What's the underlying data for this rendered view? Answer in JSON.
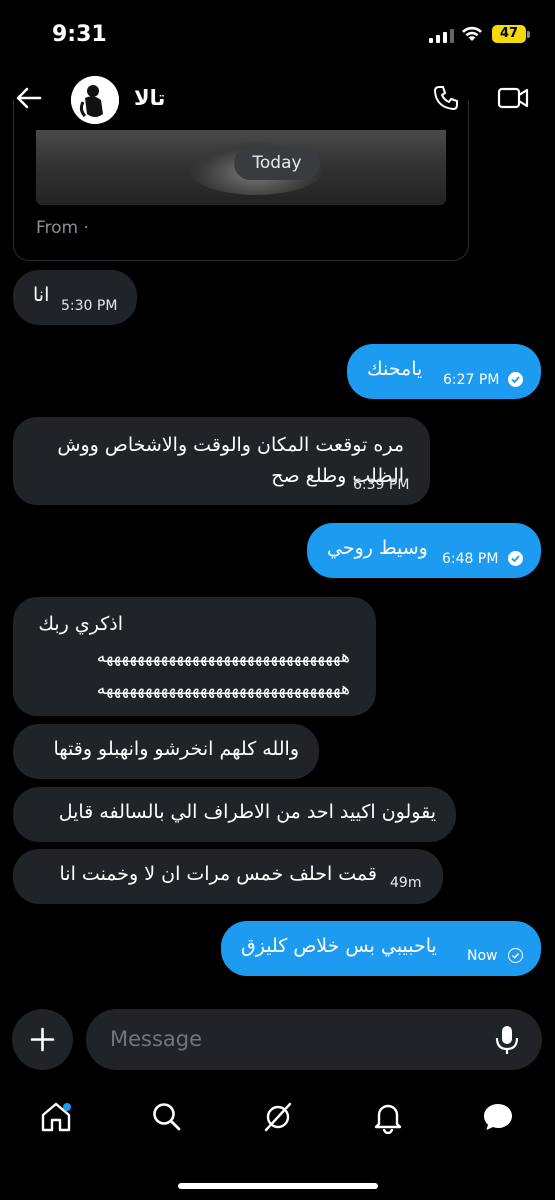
{
  "status_bar": {
    "time": "9:31",
    "battery": "47"
  },
  "header": {
    "contact_name": "تالا"
  },
  "media_card": {
    "from_label": "From ·"
  },
  "date_divider": "Today",
  "messages": [
    {
      "direction": "in",
      "lines": [
        "انا"
      ],
      "time": "5:30 PM"
    },
    {
      "direction": "out",
      "lines": [
        "يامحنك"
      ],
      "time": "6:27 PM",
      "status": "read"
    },
    {
      "direction": "in",
      "lines": [
        "مره توقعت المكان والوقت والاشخاص ووش",
        "الظلب وطلع صح"
      ],
      "time": "6:39 PM"
    },
    {
      "direction": "out",
      "lines": [
        "وسيط روحي"
      ],
      "time": "6:48 PM",
      "status": "read"
    },
    {
      "direction": "in",
      "lines": [
        "اذكري ربك",
        "هههههههههههههههههههههههههههههههه",
        "هههههههههههههههههههههههههههههههه"
      ]
    },
    {
      "direction": "in",
      "lines": [
        "والله كلهم انخرشو وانهبلو وقتها"
      ]
    },
    {
      "direction": "in",
      "lines": [
        "يقولون اكييد احد من الاطراف الي بالسالفه قايل"
      ]
    },
    {
      "direction": "in",
      "lines": [
        "قمت احلف خمس مرات ان لا وخمنت انا"
      ],
      "time": "49m"
    },
    {
      "direction": "out",
      "lines": [
        "ياحبيبي بس خلاص كليزق"
      ],
      "time": "Now",
      "status": "sent"
    }
  ],
  "composer": {
    "placeholder": "Message"
  },
  "nav": [
    "home-icon",
    "search-icon",
    "grok-icon",
    "notifications-icon",
    "messages-icon"
  ],
  "colors": {
    "accent": "#1d9bf0",
    "incoming_bubble": "#202327",
    "background": "#000000"
  }
}
